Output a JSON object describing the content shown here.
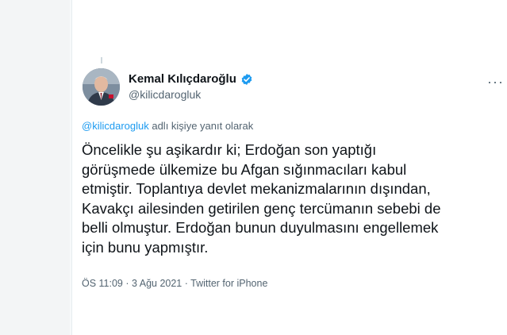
{
  "tweet": {
    "author": {
      "display_name": "Kemal Kılıçdaroğlu",
      "handle": "@kilicdarogluk",
      "verified": true
    },
    "reply_to": {
      "mention": "@kilicdarogluk",
      "suffix": " adlı kişiye yanıt olarak"
    },
    "text": "Öncelikle şu aşikardır ki; Erdoğan son yaptığı\ngörüşmede ülkemize bu Afgan sığınmacıları kabul\netmiştir. Toplantıya devlet mekanizmalarının dışından,\nKavakçı ailesinden getirilen genç tercümanın sebebi de\nbelli olmuştur. Erdoğan bunun duyulmasını engellemek\niçin bunu yapmıştır.",
    "meta": "ÖS 11:09 · 3 Ağu 2021 · Twitter for iPhone"
  },
  "icons": {
    "more": "more-icon",
    "verified": "verified-badge-icon"
  },
  "colors": {
    "accent": "#1d9bf0",
    "text": "#0f1419",
    "secondary": "#536471"
  }
}
